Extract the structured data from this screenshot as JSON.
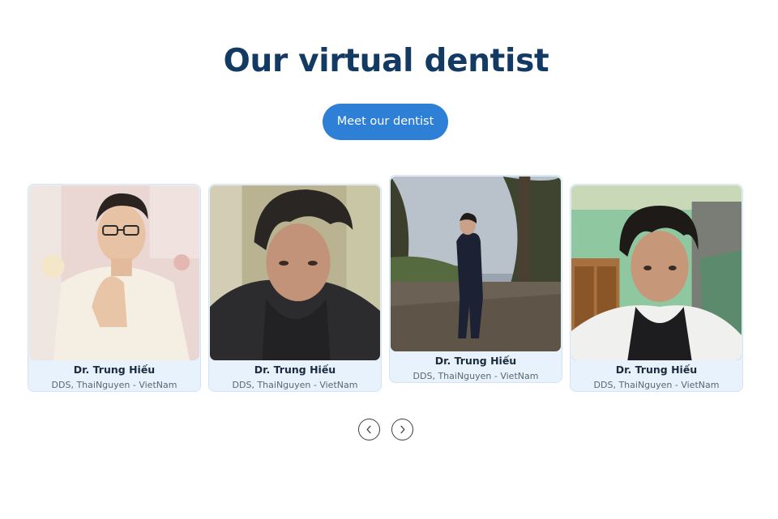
{
  "section": {
    "title": "Our virtual dentist",
    "cta_label": "Meet our dentist"
  },
  "dentists": [
    {
      "name": "Dr. Trung Hiếu",
      "credentials": "DDS, ThaiNguyen - VietNam"
    },
    {
      "name": "Dr. Trung Hiếu",
      "credentials": "DDS, ThaiNguyen - VietNam"
    },
    {
      "name": "Dr. Trung Hiếu",
      "credentials": "DDS, ThaiNguyen - VietNam"
    },
    {
      "name": "Dr. Trung Hiếu",
      "credentials": "DDS, ThaiNguyen - VietNam"
    }
  ],
  "carousel": {
    "prev_icon": "chevron-left-icon",
    "next_icon": "chevron-right-icon"
  },
  "colors": {
    "title": "#123a63",
    "accent": "#2e7fd6",
    "card_bg": "#e8f2fc"
  }
}
